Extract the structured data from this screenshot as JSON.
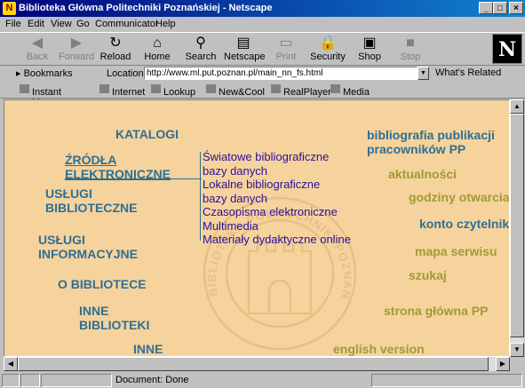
{
  "window": {
    "title": "Biblioteka Główna Politechniki Poznańskiej - Netscape",
    "minimize": "_",
    "maximize": "□",
    "close": "×"
  },
  "menu": [
    "File",
    "Edit",
    "View",
    "Go",
    "Communicator",
    "Help"
  ],
  "toolbar": [
    {
      "label": "Back",
      "icon": "back-arrow-icon",
      "glyph": "◀",
      "disabled": true
    },
    {
      "label": "Forward",
      "icon": "forward-arrow-icon",
      "glyph": "▶",
      "disabled": true
    },
    {
      "label": "Reload",
      "icon": "reload-icon",
      "glyph": "↻",
      "disabled": false
    },
    {
      "label": "Home",
      "icon": "home-icon",
      "glyph": "⌂",
      "disabled": false
    },
    {
      "label": "Search",
      "icon": "search-icon",
      "glyph": "⚲",
      "disabled": false
    },
    {
      "label": "Netscape",
      "icon": "netscape-icon",
      "glyph": "▤",
      "disabled": false
    },
    {
      "label": "Print",
      "icon": "print-icon",
      "glyph": "▭",
      "disabled": true
    },
    {
      "label": "Security",
      "icon": "lock-icon",
      "glyph": "🔒",
      "disabled": false
    },
    {
      "label": "Shop",
      "icon": "shop-icon",
      "glyph": "▣",
      "disabled": false
    },
    {
      "label": "Stop",
      "icon": "stop-icon",
      "glyph": "■",
      "disabled": true
    }
  ],
  "location": {
    "bookmarks": "Bookmarks",
    "label": "Location:",
    "url": "http://www.ml.put.poznan.pl/main_nn_fs.html",
    "related": "What's Related"
  },
  "personal": [
    "Instant Message",
    "Internet",
    "Lookup",
    "New&Cool",
    "RealPlayer",
    "Media"
  ],
  "page": {
    "left_nav": [
      "KATALOGI",
      "ŹRÓDŁA ELEKTRONICZNE",
      "USŁUGI BIBLIOTECZNE",
      "USŁUGI INFORMACYJNE",
      "O BIBLIOTECE",
      "INNE BIBLIOTEKI",
      "INNE"
    ],
    "submenu": [
      "Światowe bibliograficzne bazy danych",
      "Lokalne bibliograficzne bazy danych",
      "Czasopisma elektroniczne",
      "Multimedia",
      "Materiały dydaktyczne online"
    ],
    "right_nav": [
      "bibliografia publikacji pracowników PP",
      "aktualności",
      "godziny otwarcia",
      "konto czytelnika",
      "mapa serwisu",
      "szukaj",
      "strona główna PP",
      "english version"
    ],
    "watermark": "BIBLIOTEKA POLITECHNIKI POZNAŃSKIEJ"
  },
  "colors": {
    "page_bg": "#f6d39c",
    "nav_blue": "#2e6f95",
    "nav_olive": "#a09a38",
    "sub_link": "#2b0f9e"
  },
  "status": {
    "text": "Document: Done"
  }
}
